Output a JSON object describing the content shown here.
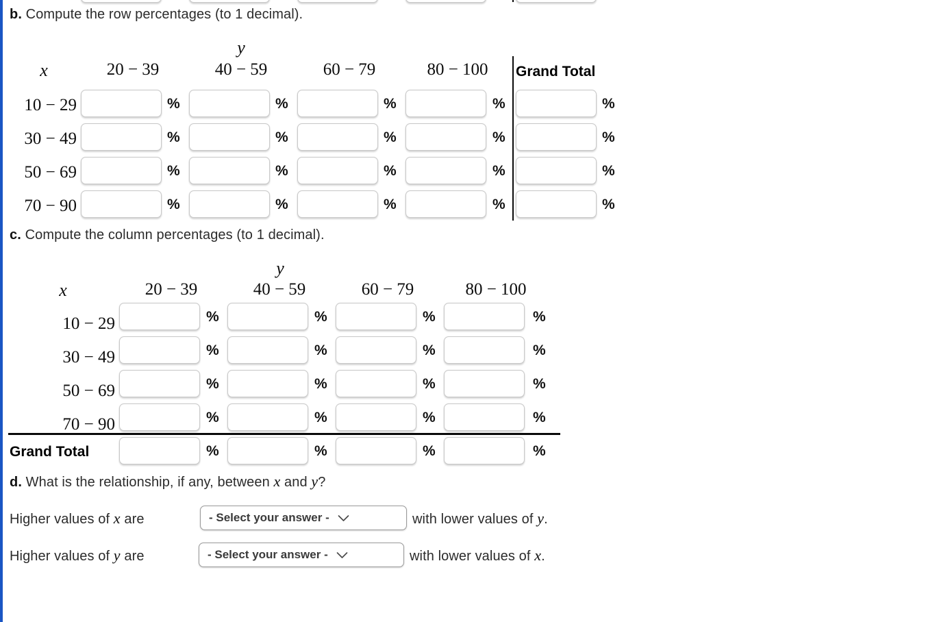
{
  "accent_color": "#1a56c4",
  "part_b": {
    "letter": "b.",
    "text": "Compute the row percentages (to 1 decimal).",
    "table": {
      "col_group_label": "y",
      "row_group_label": "x",
      "column_headers": [
        "20 − 39",
        "40 − 59",
        "60 − 79",
        "80 − 100"
      ],
      "grand_total_header": "Grand Total",
      "row_headers": [
        "10 − 29",
        "30 − 49",
        "50 − 69",
        "70 − 90"
      ],
      "percent_symbol": "%",
      "cell_value": "",
      "cell_placeholder": ""
    }
  },
  "part_c": {
    "letter": "c.",
    "text": "Compute the column percentages (to 1 decimal).",
    "table": {
      "col_group_label": "y",
      "row_group_label": "x",
      "column_headers": [
        "20 − 39",
        "40 − 59",
        "60 − 79",
        "80 − 100"
      ],
      "row_headers": [
        "10 − 29",
        "30 − 49",
        "50 − 69",
        "70 − 90"
      ],
      "grand_total_row_label": "Grand Total",
      "percent_symbol": "%",
      "cell_value": "",
      "cell_placeholder": ""
    }
  },
  "part_d": {
    "letter": "d.",
    "text_before_x": "What is the relationship, if any, between",
    "var_x": "x",
    "text_and": "and",
    "var_y": "y",
    "text_after": "?",
    "statements": [
      {
        "lead": "Higher values of",
        "lead_var": "x",
        "lead_tail": "are",
        "select_value": "- Select your answer -",
        "tail": "with lower values of",
        "tail_var": "y",
        "tail_end": "."
      },
      {
        "lead": "Higher values of",
        "lead_var": "y",
        "lead_tail": "are",
        "select_value": "- Select your answer -",
        "tail": "with lower values of",
        "tail_var": "x",
        "tail_end": "."
      }
    ]
  }
}
